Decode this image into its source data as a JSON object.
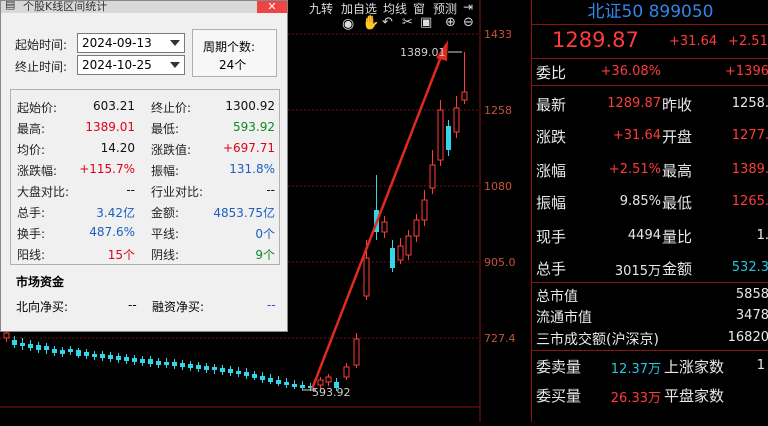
{
  "toolbar": {
    "items": [
      "九转",
      "加自选",
      "均线",
      "窗",
      "预测"
    ]
  },
  "chart": {
    "price_labels": [
      "1433",
      "1258",
      "1080",
      "905.0",
      "727.4"
    ],
    "high_marker": "1389.01",
    "low_marker": "593.92",
    "colors": {
      "up": "#ff3b3b",
      "down": "#33d6e8",
      "arrow": "#e02a1f",
      "grid": "#6b1212"
    }
  },
  "dialog": {
    "title": "个股K线区间统计",
    "start_label": "起始时间:",
    "start_value": "2024-09-13",
    "end_label": "终止时间:",
    "end_value": "2024-10-25",
    "period_label": "周期个数:",
    "period_value": "24个",
    "stats": [
      {
        "k1": "起始价:",
        "v1": "603.21",
        "c1": "black",
        "k2": "终止价:",
        "v2": "1300.92",
        "c2": "black"
      },
      {
        "k1": "最高:",
        "v1": "1389.01",
        "c1": "red",
        "k2": "最低:",
        "v2": "593.92",
        "c2": "green"
      },
      {
        "k1": "均价:",
        "v1": "14.20",
        "c1": "black",
        "k2": "涨跌值:",
        "v2": "+697.71",
        "c2": "red"
      },
      {
        "k1": "涨跌幅:",
        "v1": "+115.7%",
        "c1": "red",
        "k2": "振幅:",
        "v2": "131.8%",
        "c2": "blue"
      },
      {
        "k1": "大盘对比:",
        "v1": "--",
        "c1": "black",
        "k2": "行业对比:",
        "v2": "--",
        "c2": "black"
      },
      {
        "k1": "总手:",
        "v1": "3.42亿",
        "c1": "blue",
        "k2": "金额:",
        "v2": "4853.75亿",
        "c2": "blue"
      },
      {
        "k1": "换手:",
        "v1": "487.6%",
        "c1": "blue",
        "k2": "平线:",
        "v2": "0个",
        "c2": "blue"
      },
      {
        "k1": "阳线:",
        "v1": "15个",
        "c1": "red",
        "k2": "阴线:",
        "v2": "9个",
        "c2": "green"
      }
    ],
    "capital_title": "市场资金",
    "north_label": "北向净买:",
    "north_value": "--",
    "margin_label": "融资净买:",
    "margin_value": "--"
  },
  "quote": {
    "title": "北证50 899050",
    "price": "1289.87",
    "change": "+31.64",
    "change_pct": "+2.51",
    "rows": [
      {
        "k1": "委比",
        "v1": "+36.08%",
        "c1": "red",
        "k2": "",
        "v2": "+1396",
        "c2": "red"
      },
      {
        "k1": "最新",
        "v1": "1289.87",
        "c1": "red",
        "k2": "昨收",
        "v2": "1258.",
        "c2": "white"
      },
      {
        "k1": "涨跌",
        "v1": "+31.64",
        "c1": "red",
        "k2": "开盘",
        "v2": "1277.",
        "c2": "red"
      },
      {
        "k1": "涨幅",
        "v1": "+2.51%",
        "c1": "red",
        "k2": "最高",
        "v2": "1389.",
        "c2": "red"
      },
      {
        "k1": "振幅",
        "v1": "9.85%",
        "c1": "white",
        "k2": "最低",
        "v2": "1265.",
        "c2": "red"
      },
      {
        "k1": "现手",
        "v1": "4494",
        "c1": "white",
        "k2": "量比",
        "v2": "1.",
        "c2": "white"
      },
      {
        "k1": "总手",
        "v1": "3015万",
        "c1": "white",
        "k2": "金额",
        "v2": "532.3",
        "c2": "cyan"
      }
    ],
    "mkt_rows": [
      {
        "k": "总市值",
        "v": "5858"
      },
      {
        "k": "流通市值",
        "v": "3478"
      },
      {
        "k": "三市成交额(沪深京)",
        "v": "16820"
      }
    ],
    "bottom_rows": [
      {
        "k1": "委卖量",
        "v1": "12.37万",
        "k2": "上涨家数",
        "v2": "1"
      },
      {
        "k1": "委买量",
        "v1": "26.33万",
        "k2": "平盘家数",
        "v2": ""
      },
      {
        "k1": "",
        "v1": "",
        "k2": "",
        "v2": ""
      }
    ]
  }
}
